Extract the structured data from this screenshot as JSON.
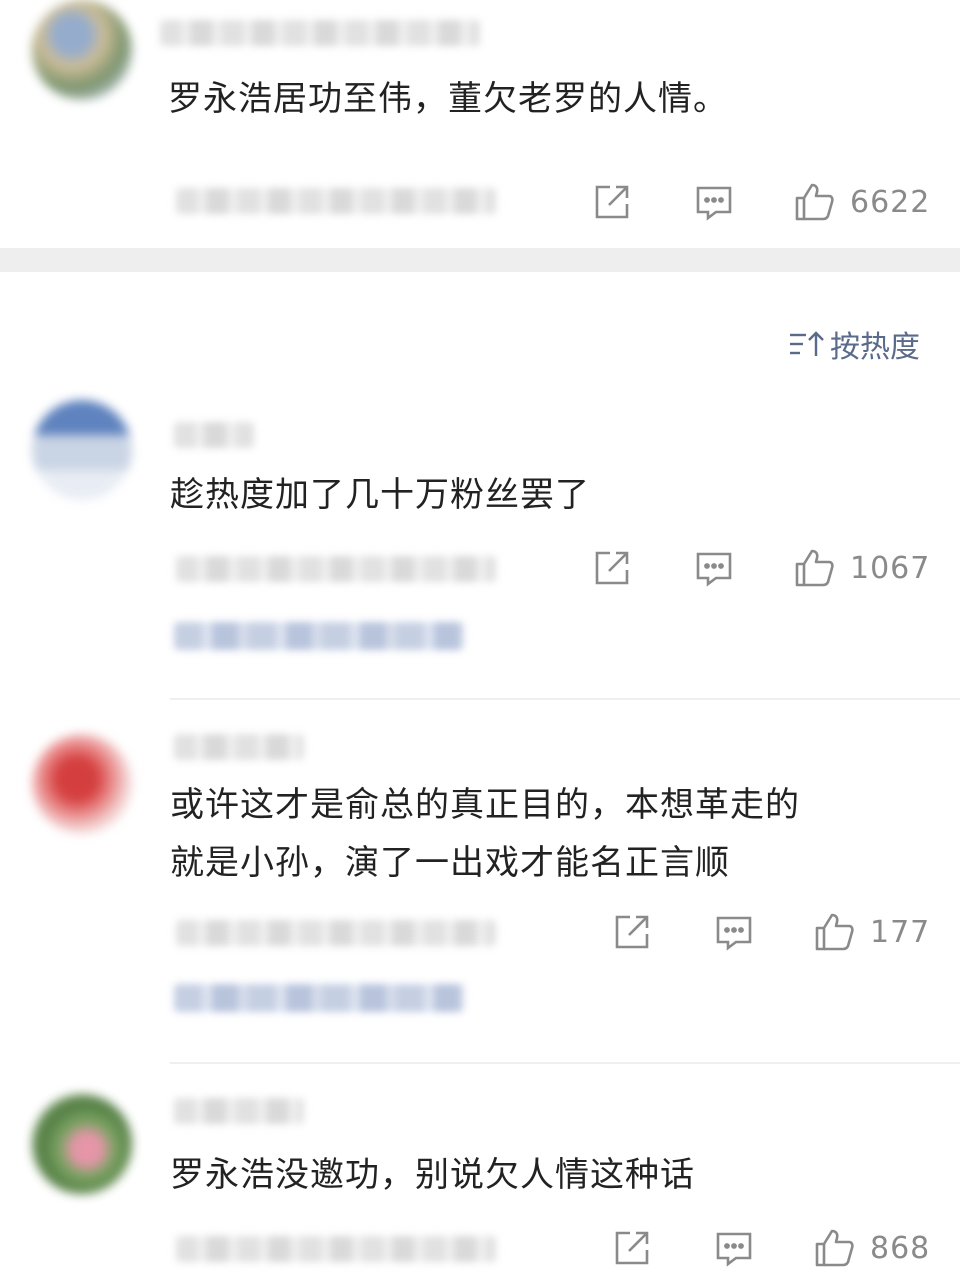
{
  "sort": {
    "label": "按热度",
    "icon": "sort-desc-icon"
  },
  "comments": [
    {
      "text_lines": [
        "罗永浩居功至伟，董欠老罗的人情。"
      ],
      "likes": "6622"
    },
    {
      "text_lines": [
        "趁热度加了几十万粉丝罢了"
      ],
      "likes": "1067"
    },
    {
      "text_lines": [
        "或许这才是俞总的真正目的，本想革走的",
        "就是小孙，演了一出戏才能名正言顺"
      ],
      "likes": "177"
    },
    {
      "text_lines": [
        "罗永浩没邀功，别说欠人情这种话"
      ],
      "likes": "868"
    }
  ],
  "icons": {
    "share": "share-icon",
    "reply": "comment-icon",
    "like": "thumbs-up-icon"
  },
  "colors": {
    "text": "#222222",
    "meta": "#8a8a8a",
    "sort": "#5a6a8a",
    "divider": "#efefef"
  }
}
